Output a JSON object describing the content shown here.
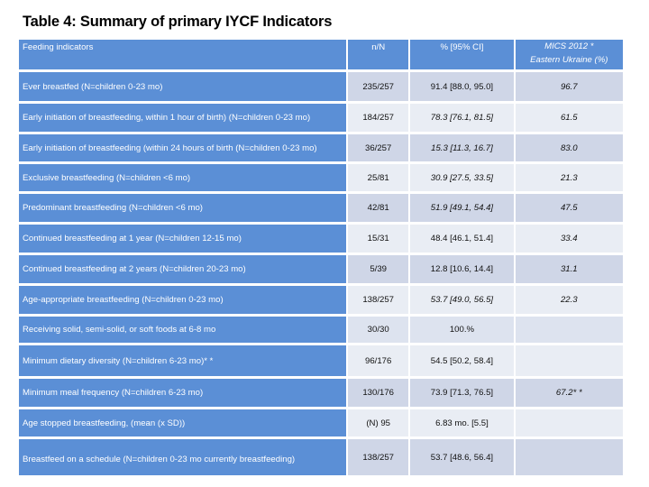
{
  "title": "Table 4: Summary of primary IYCF Indicators",
  "table": {
    "headers": {
      "indicator": "Feeding indicators",
      "nN": "n/N",
      "pct": "% [95% CI]",
      "mics_line1": "MICS 2012 *",
      "mics_line2": "Eastern Ukraine (%)"
    },
    "rows": [
      {
        "indicator": "Ever breastfed (N=children 0-23 mo)",
        "nN": "235/257",
        "pct": "91.4 [88.0, 95.0]",
        "mics": "96.7"
      },
      {
        "indicator": "Early initiation of breastfeeding, within 1 hour of birth) (N=children 0-23 mo)",
        "nN": "184/257",
        "pct": "78.3 [76.1, 81.5]",
        "mics": "61.5"
      },
      {
        "indicator": "Early initiation of breastfeeding (within 24 hours of birth (N=children 0-23 mo)",
        "nN": "36/257",
        "pct": "15.3 [11.3, 16.7]",
        "mics": "83.0"
      },
      {
        "indicator": "Exclusive breastfeeding (N=children <6 mo)",
        "nN": "25/81",
        "pct": "30.9 [27.5, 33.5]",
        "mics": "21.3"
      },
      {
        "indicator": "Predominant breastfeeding (N=children <6 mo)",
        "nN": "42/81",
        "pct": "51.9 [49.1, 54.4]",
        "mics": "47.5"
      },
      {
        "indicator": "Continued breastfeeding at 1 year (N=children 12-15 mo)",
        "nN": "15/31",
        "pct": "48.4 [46.1, 51.4]",
        "mics": "33.4"
      },
      {
        "indicator": "Continued breastfeeding at 2 years (N=children 20-23 mo)",
        "nN": "5/39",
        "pct": "12.8 [10.6, 14.4]",
        "mics": "31.1"
      },
      {
        "indicator": "Age-appropriate breastfeeding (N=children 0-23 mo)",
        "nN": "138/257",
        "pct": "53.7 [49.0, 56.5]",
        "mics": "22.3"
      },
      {
        "indicator": "Receiving solid, semi-solid, or soft foods at 6-8 mo",
        "nN": "30/30",
        "pct": "100.%",
        "mics": ""
      },
      {
        "indicator": "Minimum dietary diversity (N=children 6-23 mo)* *",
        "nN": "96/176",
        "pct": "54.5 [50.2, 58.4]",
        "mics": ""
      },
      {
        "indicator": "Minimum meal frequency (N=children 6-23 mo)",
        "nN": "130/176",
        "pct": "73.9  [71.3, 76.5]",
        "mics": "67.2* *"
      },
      {
        "indicator": "Age stopped breastfeeding, (mean (x SD))",
        "nN": "(N) 95",
        "pct": "6.83 mo. [5.5]",
        "mics": ""
      },
      {
        "indicator": "Breastfeed on a schedule (N=children 0-23 mo currently breastfeeding)",
        "nN": "138/257",
        "pct": "53.7 [48.6, 56.4]",
        "mics": ""
      }
    ]
  }
}
